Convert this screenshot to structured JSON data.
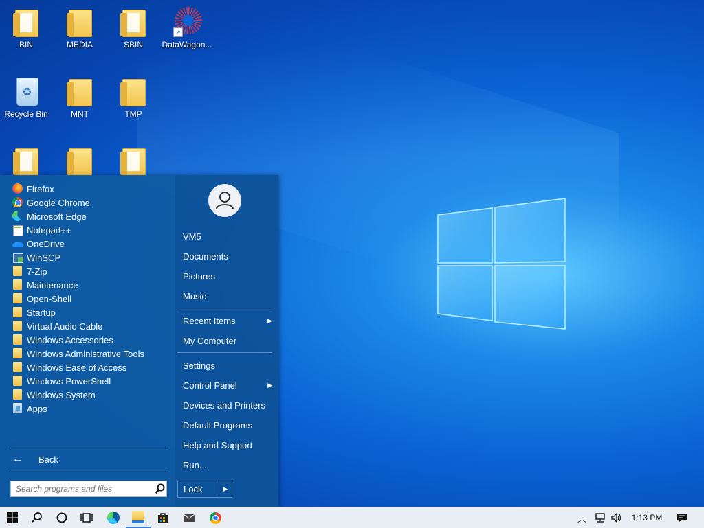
{
  "desktop": {
    "icons": [
      {
        "label": "BIN",
        "icon": "folder-icon"
      },
      {
        "label": "MEDIA",
        "icon": "folder-icon"
      },
      {
        "label": "SBIN",
        "icon": "folder-icon"
      },
      {
        "label": "DataWagon...",
        "icon": "datawagon-shortcut-icon"
      },
      {
        "label": "Recycle Bin",
        "icon": "recycle-bin-icon"
      },
      {
        "label": "MNT",
        "icon": "folder-icon"
      },
      {
        "label": "TMP",
        "icon": "folder-icon"
      }
    ]
  },
  "start_menu": {
    "programs": [
      {
        "label": "Firefox",
        "icon": "firefox-icon"
      },
      {
        "label": "Google Chrome",
        "icon": "chrome-icon"
      },
      {
        "label": "Microsoft Edge",
        "icon": "edge-icon"
      },
      {
        "label": "Notepad++",
        "icon": "notepadpp-icon"
      },
      {
        "label": "OneDrive",
        "icon": "onedrive-icon"
      },
      {
        "label": "WinSCP",
        "icon": "winscp-icon"
      },
      {
        "label": "7-Zip",
        "icon": "folder-icon"
      },
      {
        "label": "Maintenance",
        "icon": "folder-icon"
      },
      {
        "label": "Open-Shell",
        "icon": "folder-icon"
      },
      {
        "label": "Startup",
        "icon": "folder-icon"
      },
      {
        "label": "Virtual Audio Cable",
        "icon": "folder-icon"
      },
      {
        "label": "Windows Accessories",
        "icon": "folder-icon"
      },
      {
        "label": "Windows Administrative Tools",
        "icon": "folder-icon"
      },
      {
        "label": "Windows Ease of Access",
        "icon": "folder-icon"
      },
      {
        "label": "Windows PowerShell",
        "icon": "folder-icon"
      },
      {
        "label": "Windows System",
        "icon": "folder-icon"
      },
      {
        "label": "Apps",
        "icon": "apps-icon"
      }
    ],
    "back_label": "Back",
    "search_placeholder": "Search programs and files",
    "right": {
      "user": "VM5",
      "documents": "Documents",
      "pictures": "Pictures",
      "music": "Music",
      "recent_items": "Recent Items",
      "my_computer": "My Computer",
      "settings": "Settings",
      "control_panel": "Control Panel",
      "devices_printers": "Devices and Printers",
      "default_programs": "Default Programs",
      "help_support": "Help and Support",
      "run": "Run...",
      "lock": "Lock"
    }
  },
  "taskbar": {
    "clock": "1:13 PM",
    "pinned": [
      "start-icon",
      "search-icon",
      "cortana-icon",
      "task-view-icon",
      "edge-icon",
      "file-explorer-icon",
      "store-icon",
      "mail-icon",
      "chrome-icon"
    ]
  }
}
